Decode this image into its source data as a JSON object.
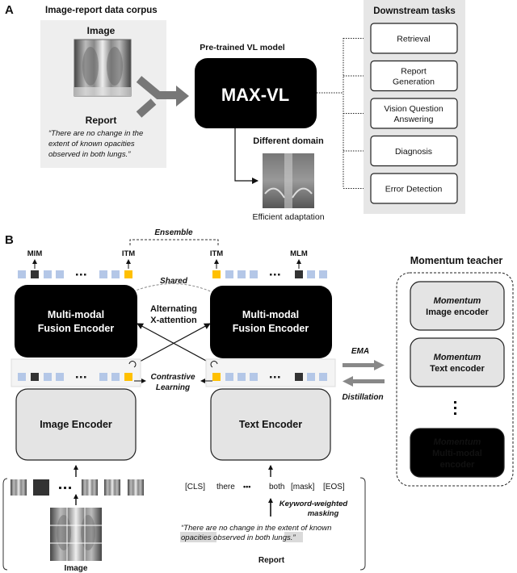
{
  "panel_a": {
    "label": "A",
    "corpus": {
      "title": "Image-report data corpus",
      "image_label": "Image",
      "report_label": "Report",
      "report_lines": [
        "“There are no change in the",
        "extent of known opacities",
        "observed in both lungs.”"
      ]
    },
    "model": {
      "title": "Pre-trained VL model",
      "name": "MAX-VL"
    },
    "domain": {
      "title": "Different domain",
      "caption": "Efficient adaptation"
    },
    "downstream": {
      "title": "Downstream tasks",
      "tasks": [
        {
          "lines": [
            "Retrieval"
          ]
        },
        {
          "lines": [
            "Report",
            "Generation"
          ]
        },
        {
          "lines": [
            "Vision Question",
            "Answering"
          ]
        },
        {
          "lines": [
            "Diagnosis"
          ]
        },
        {
          "lines": [
            "Error Detection"
          ]
        }
      ]
    }
  },
  "panel_b": {
    "label": "B",
    "ensemble": "Ensemble",
    "shared": "Shared",
    "mim": "MIM",
    "itm_left": "ITM",
    "itm_right": "ITM",
    "mlm": "MLM",
    "fusion_left": [
      "Multi-modal",
      "Fusion Encoder"
    ],
    "fusion_right": [
      "Multi-modal",
      "Fusion Encoder"
    ],
    "alternating": [
      "Alternating",
      "X-attention"
    ],
    "contrastive": [
      "Contrastive",
      "Learning"
    ],
    "ellipsis": "•••",
    "image_encoder": "Image Encoder",
    "text_encoder": "Text Encoder",
    "image_caption": "Image",
    "tokens": [
      "[CLS]",
      "there",
      "both",
      "[mask]",
      "[EOS]"
    ],
    "masking": [
      "Keyword-weighted",
      "masking"
    ],
    "report_line1": "“There are no change in the extent of known",
    "report_line2_parts": [
      "opacities",
      " observed in both ",
      "lungs",
      ".”"
    ],
    "report_caption": "Report",
    "ema": "EMA",
    "distillation": "Distillation",
    "teacher": {
      "title": "Momentum teacher",
      "blocks": [
        {
          "prefix": "Momentum",
          "lines": [
            "Image encoder"
          ],
          "dark": false
        },
        {
          "prefix": "Momentum",
          "lines": [
            "Text encoder"
          ],
          "dark": false
        },
        {
          "prefix": "Momentum",
          "lines": [
            "Multi-modal",
            "encoder"
          ],
          "dark": true
        }
      ]
    },
    "colors": {
      "token": "#b4c7e7",
      "masked": "#333333",
      "cls": "#ffc000",
      "panel_bg": "#efefef",
      "encoder_bg": "#e4e4e4"
    }
  }
}
